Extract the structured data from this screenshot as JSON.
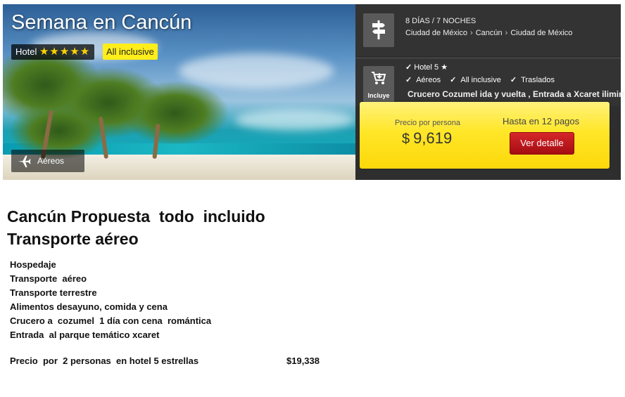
{
  "banner": {
    "title": "Semana en Cancún",
    "hotel_label": "Hotel",
    "stars": "★★★★★",
    "all_inclusive_badge": "All inclusive",
    "transport_chip": "Aéreos",
    "duration": "8 DÍAS / 7 NOCHES",
    "route": [
      "Ciudad de México",
      "Cancún",
      "Ciudad de México"
    ],
    "includes_label": "Incluye",
    "includes_hotel": "Hotel 5",
    "includes_items": [
      "Aéreos",
      "All inclusive",
      "Traslados"
    ],
    "includes_extra": "Crucero Cozumel ida y vuelta , Entrada  a Xcaret ilimirtada",
    "price_label": "Precio por persona",
    "price_currency": "$",
    "price_value": "9,619",
    "payments": "Hasta en 12 pagos",
    "detail_button": "Ver detalle"
  },
  "content": {
    "heading_line1": "Cancún Propuesta  todo  incluido",
    "heading_line2": "Transporte aéreo",
    "items": [
      "Hospedaje",
      "Transporte  aéreo",
      "Transporte terrestre",
      "Alimentos desayuno, comida y cena",
      "Crucero a  cozumel  1 día con cena  romántica",
      "Entrada  al parque temático xcaret"
    ],
    "price_label": "Precio  por  2 personas  en hotel 5 estrellas",
    "price_value": "$19,338"
  },
  "colors": {
    "accent_yellow": "#ffe628",
    "button_red": "#c4161c",
    "panel_dark": "#333333"
  }
}
